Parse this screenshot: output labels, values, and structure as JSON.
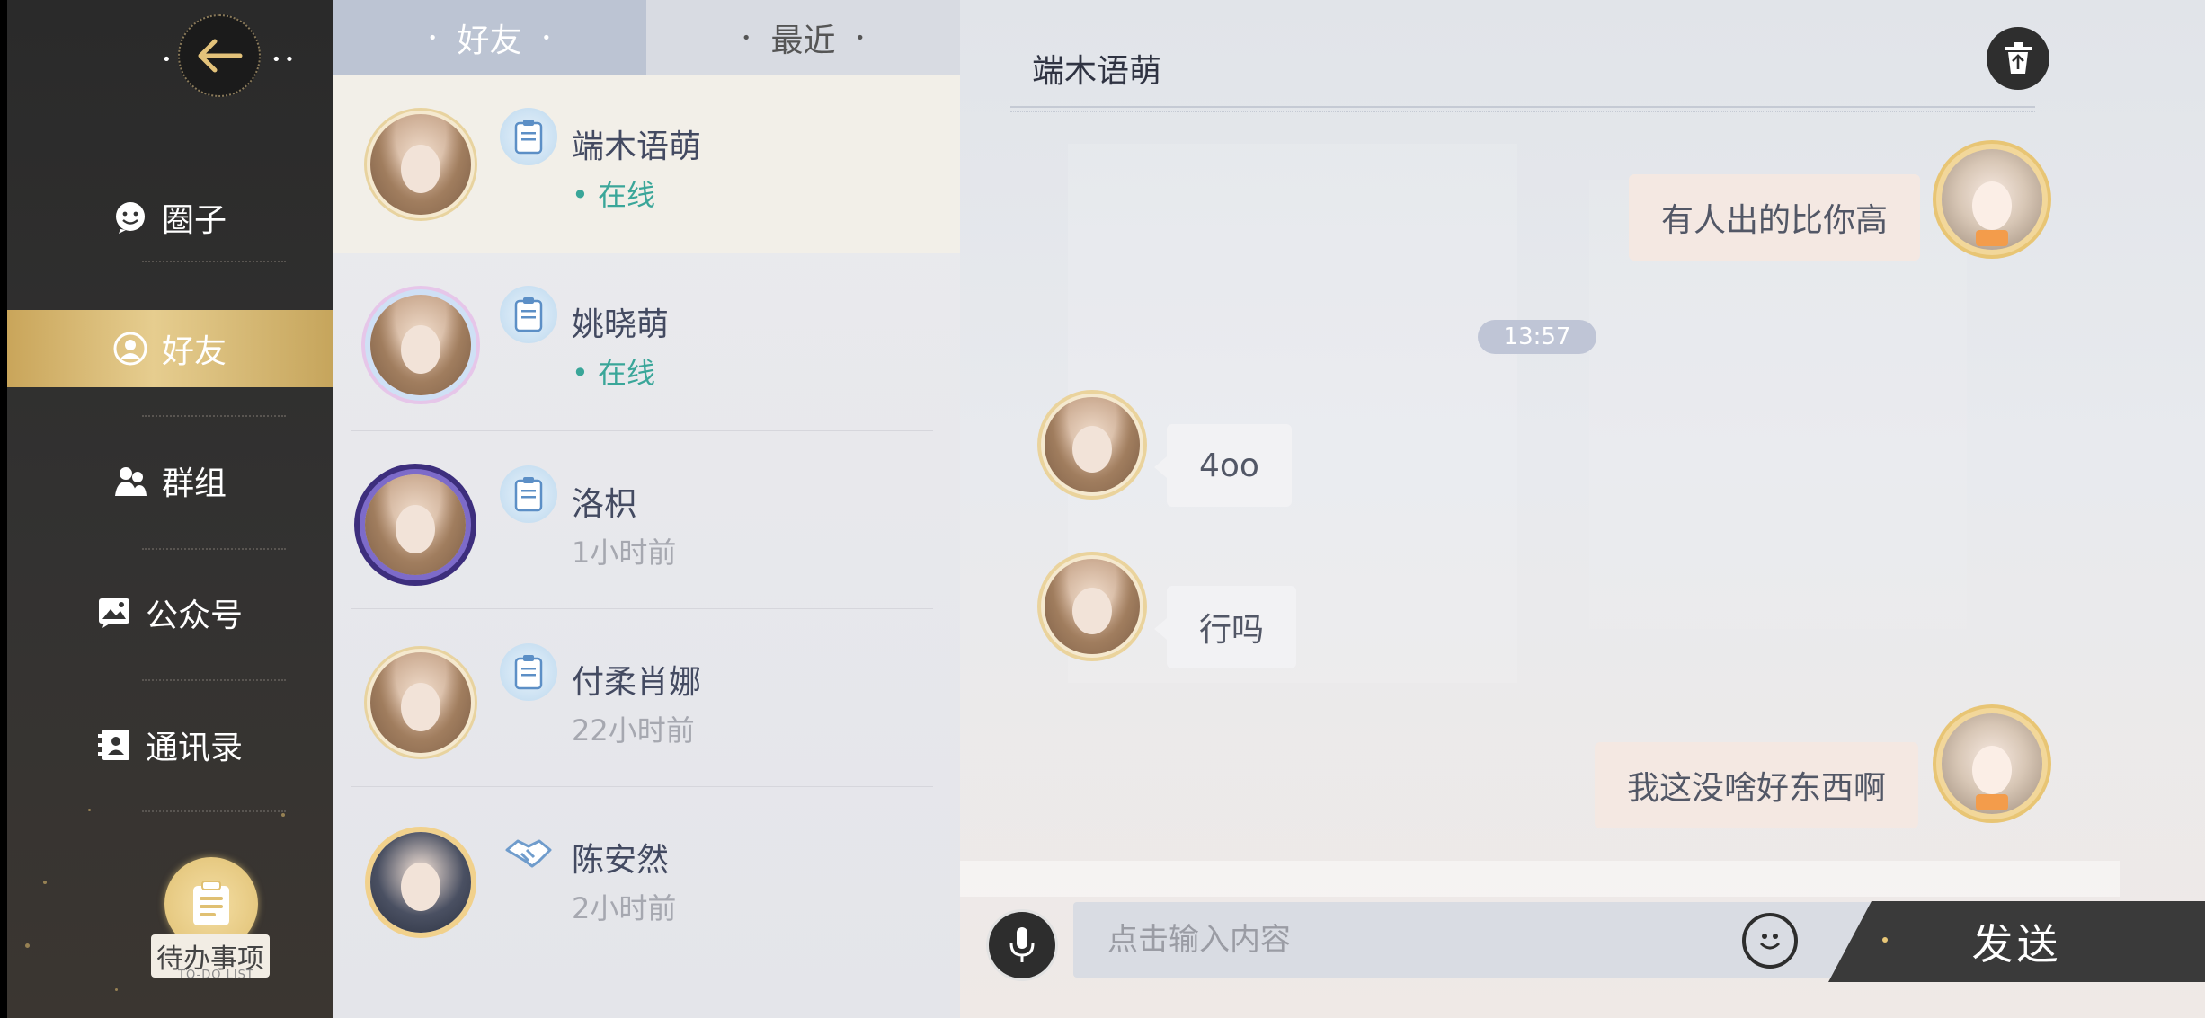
{
  "sidebar": {
    "nav": [
      {
        "label": "圈子",
        "icon": "smile-bubble-icon"
      },
      {
        "label": "好友",
        "icon": "friend-face-icon"
      },
      {
        "label": "群组",
        "icon": "group-icon"
      },
      {
        "label": "公众号",
        "icon": "image-bubble-icon"
      },
      {
        "label": "通讯录",
        "icon": "contacts-book-icon"
      }
    ],
    "active_index": 1,
    "todo_label": "待办事项",
    "todo_sub": "TO-DO LIST"
  },
  "tabs": [
    {
      "label": "好友",
      "active": true
    },
    {
      "label": "最近",
      "active": false
    }
  ],
  "friends": [
    {
      "name": "端木语萌",
      "status": "在线",
      "online": true,
      "badge": "note-badge-icon"
    },
    {
      "name": "姚晓萌",
      "status": "在线",
      "online": true,
      "badge": "note-badge-icon"
    },
    {
      "name": "洛枳",
      "status": "1小时前",
      "online": false,
      "badge": "note-badge-icon"
    },
    {
      "name": "付柔肖娜",
      "status": "22小时前",
      "online": false,
      "badge": "note-badge-icon"
    },
    {
      "name": "陈安然",
      "status": "2小时前",
      "online": false,
      "badge": "handshake-icon"
    }
  ],
  "chat": {
    "title": "端木语萌",
    "messages": [
      {
        "from": "me",
        "text": "有人出的比你高"
      },
      {
        "time": "13:57"
      },
      {
        "from": "them",
        "text": "4oo"
      },
      {
        "from": "them",
        "text": "行吗"
      },
      {
        "from": "me",
        "text": "我这没啥好东西啊"
      }
    ],
    "input_placeholder": "点击输入内容",
    "send_label": "发送"
  },
  "colors": {
    "online": "#3aa699",
    "accent_gold": "#e0c072",
    "tab_active": "#bcc4d3"
  }
}
